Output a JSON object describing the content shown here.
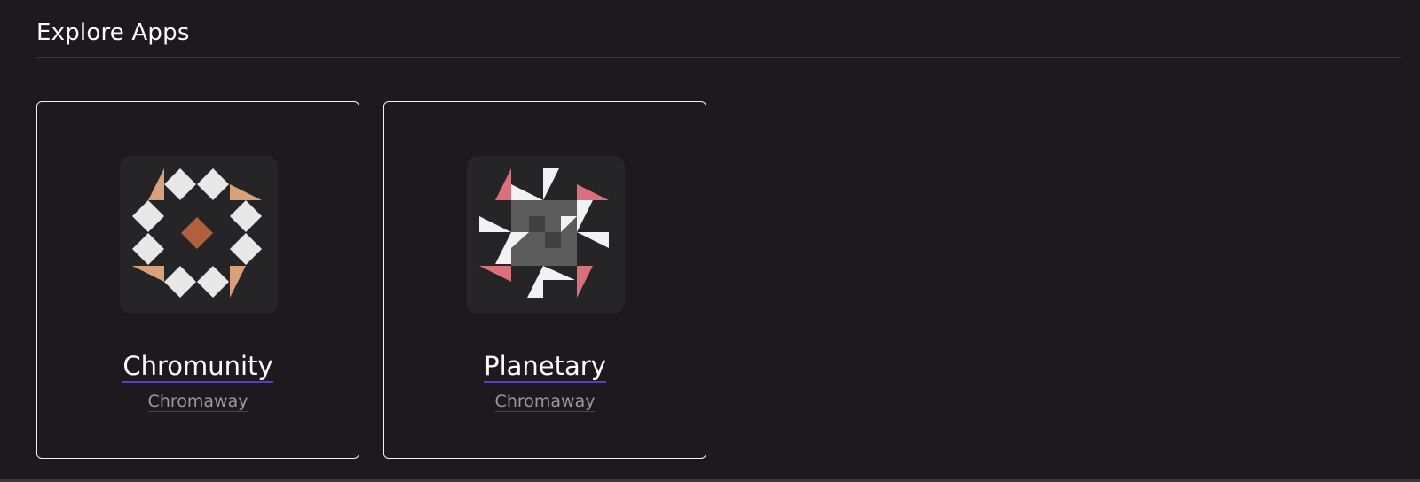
{
  "section": {
    "title": "Explore Apps"
  },
  "apps": [
    {
      "name": "Chromunity",
      "author": "Chromaway",
      "icon": "chromunity-logo-icon",
      "colors": {
        "tile": "#e8e8e8",
        "accent": "#d9a07a",
        "center": "#b0603a",
        "background": "#252426"
      }
    },
    {
      "name": "Planetary",
      "author": "Chromaway",
      "icon": "planetary-logo-icon",
      "colors": {
        "blade": "#f2f2f2",
        "accent": "#d9707a",
        "overlay": "#8a8a8a",
        "background": "#252426"
      }
    }
  ],
  "colors": {
    "page_background": "#1d191e",
    "card_border": "#f2f2f2",
    "link_underline": "#5b3bc4",
    "secondary_text": "#9b979d"
  }
}
